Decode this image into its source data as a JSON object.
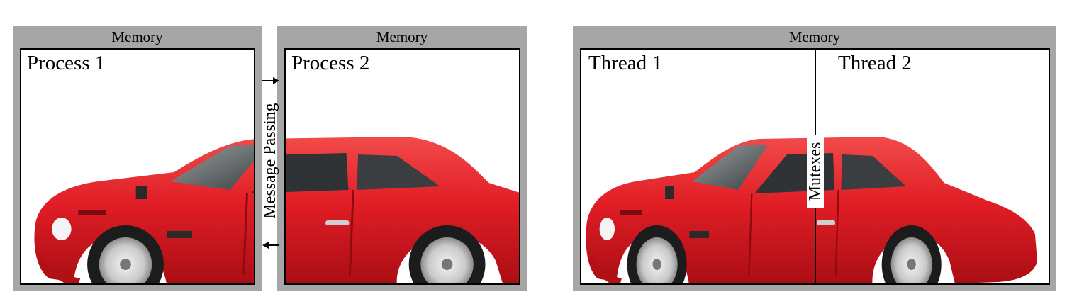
{
  "left_diagram": {
    "memory_1": {
      "label": "Memory"
    },
    "memory_2": {
      "label": "Memory"
    },
    "process_1": {
      "title": "Process 1"
    },
    "process_2": {
      "title": "Process 2"
    },
    "channel": {
      "label": "Message Passing"
    }
  },
  "right_diagram": {
    "memory": {
      "label": "Memory"
    },
    "thread_1": {
      "title": "Thread 1"
    },
    "thread_2": {
      "title": "Thread 2"
    },
    "sync": {
      "label": "Mutexes"
    }
  },
  "colors": {
    "memory_background": "#a6a6a6",
    "car_body": "#e01d25",
    "frame_border": "#000000"
  },
  "icons": [
    "car-image",
    "arrow-right-icon",
    "arrow-left-icon"
  ]
}
